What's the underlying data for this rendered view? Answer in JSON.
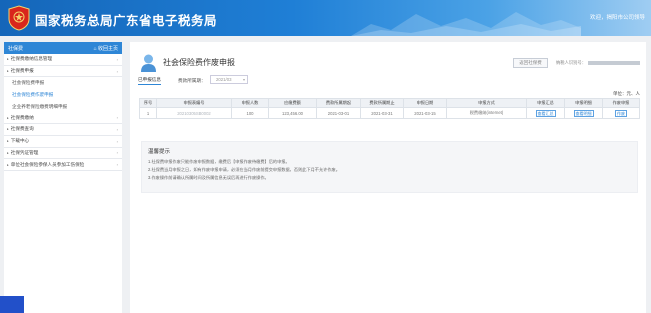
{
  "header": {
    "site_title": "国家税务总局广东省电子税务局",
    "welcome_prefix": "欢迎，",
    "welcome_user": "揭阳市公司领导"
  },
  "sidebar": {
    "title": "社保费",
    "collapse_label": "收回主页",
    "items": [
      {
        "label": "社保费缴纳信息管理",
        "type": "group"
      },
      {
        "label": "社保费申报",
        "type": "group"
      },
      {
        "label": "社会保险费申报",
        "type": "sub"
      },
      {
        "label": "社会保险费作废申报",
        "type": "sub",
        "active": true
      },
      {
        "label": "企业养老保险缴费明细申报",
        "type": "sub"
      },
      {
        "label": "社保费缴纳",
        "type": "group"
      },
      {
        "label": "社保费查询",
        "type": "group"
      },
      {
        "label": "下载中心",
        "type": "group"
      },
      {
        "label": "社保凭证管理",
        "type": "group"
      },
      {
        "label": "单位社会保险参保人员参加工伤保险",
        "type": "group"
      }
    ]
  },
  "page": {
    "title": "社会保险费作废申报",
    "return_button": "返回社保费",
    "company_label": "纳税人识别号：",
    "tab_label": "已申报信息",
    "period_label": "费款所属期：",
    "period_value": "2021/03",
    "unit_label": "单位：元、人"
  },
  "table": {
    "headers": [
      "序号",
      "申报表编号",
      "申报人数",
      "应缴费额",
      "费款所属期起",
      "费款所属期止",
      "申报日期",
      "申报方式",
      "申报汇总",
      "申报明细",
      "作废申报"
    ],
    "rows": [
      {
        "seq": "1",
        "code": "20210305SB0002",
        "count": "100",
        "amount": "123,456.00",
        "start": "2021-03-01",
        "end": "2021-03-31",
        "date": "2021-03-15",
        "method": "税费缴纳(internet)",
        "summary_btn": "查看汇总",
        "detail_btn": "查看明细",
        "void_btn": "作废"
      }
    ]
  },
  "tips": {
    "title": "温馨提示",
    "lines": [
      "1.社保费申报作废只能作废申报数据，缴费后【申报作废待缴费】后的申报。",
      "2.社保费当月申报之日，如有作废申报申请，必须在当月作废前提交申报数据，否则此下月不允许作废。",
      "3.作废操作前请确认所属时间及所属信息无误后再进行作废操作。"
    ]
  }
}
